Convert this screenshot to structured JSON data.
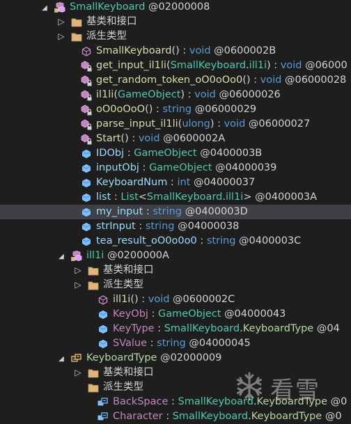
{
  "tree": {
    "rows": [
      {
        "indent": 78,
        "arrow": "open",
        "icon": "class-icon",
        "parts": [
          {
            "t": "SmallKeyboard",
            "c": "c-class"
          },
          {
            "t": " @02000008",
            "c": "c-plain"
          }
        ]
      },
      {
        "indent": 102,
        "arrow": "closed",
        "icon": "folder-icon",
        "parts": [
          {
            "t": "基类和接口",
            "c": "c-folder"
          }
        ]
      },
      {
        "indent": 102,
        "arrow": "closed",
        "icon": "folder-icon",
        "parts": [
          {
            "t": "派生类型",
            "c": "c-folder"
          }
        ]
      },
      {
        "indent": 116,
        "arrow": "none",
        "icon": "method-public-icon",
        "parts": [
          {
            "t": "SmallKeyboard",
            "c": "c-method"
          },
          {
            "t": "() : ",
            "c": "c-plain"
          },
          {
            "t": "void",
            "c": "c-kw"
          },
          {
            "t": " @0600002B",
            "c": "c-plain"
          }
        ]
      },
      {
        "indent": 116,
        "arrow": "none",
        "icon": "method-private-icon",
        "parts": [
          {
            "t": "get_input_il1li",
            "c": "c-method"
          },
          {
            "t": "(",
            "c": "c-plain"
          },
          {
            "t": "SmallKeyboard",
            "c": "c-class"
          },
          {
            "t": ".",
            "c": "c-plain"
          },
          {
            "t": "ill1i",
            "c": "c-class"
          },
          {
            "t": ") : ",
            "c": "c-plain"
          },
          {
            "t": "void",
            "c": "c-kw"
          },
          {
            "t": " @06000",
            "c": "c-plain"
          }
        ]
      },
      {
        "indent": 116,
        "arrow": "none",
        "icon": "method-private-icon",
        "parts": [
          {
            "t": "get_random_token_oO0oOo0",
            "c": "c-method"
          },
          {
            "t": "() : ",
            "c": "c-plain"
          },
          {
            "t": "void",
            "c": "c-kw"
          },
          {
            "t": " @06000028",
            "c": "c-plain"
          }
        ]
      },
      {
        "indent": 116,
        "arrow": "none",
        "icon": "method-private-icon",
        "parts": [
          {
            "t": "il1li",
            "c": "c-method"
          },
          {
            "t": "(",
            "c": "c-plain"
          },
          {
            "t": "GameObject",
            "c": "c-class"
          },
          {
            "t": ") : ",
            "c": "c-plain"
          },
          {
            "t": "void",
            "c": "c-kw"
          },
          {
            "t": " @06000026",
            "c": "c-plain"
          }
        ]
      },
      {
        "indent": 116,
        "arrow": "none",
        "icon": "method-private-icon",
        "parts": [
          {
            "t": "oO0oOoO",
            "c": "c-method"
          },
          {
            "t": "() : ",
            "c": "c-plain"
          },
          {
            "t": "string",
            "c": "c-kw"
          },
          {
            "t": " @06000029",
            "c": "c-plain"
          }
        ]
      },
      {
        "indent": 116,
        "arrow": "none",
        "icon": "method-private-icon",
        "parts": [
          {
            "t": "parse_input_il1li",
            "c": "c-method"
          },
          {
            "t": "(",
            "c": "c-plain"
          },
          {
            "t": "ulong",
            "c": "c-kw"
          },
          {
            "t": ") : ",
            "c": "c-plain"
          },
          {
            "t": "void",
            "c": "c-kw"
          },
          {
            "t": " @06000027",
            "c": "c-plain"
          }
        ]
      },
      {
        "indent": 116,
        "arrow": "none",
        "icon": "method-private-icon",
        "parts": [
          {
            "t": "Start",
            "c": "c-method"
          },
          {
            "t": "() : ",
            "c": "c-plain"
          },
          {
            "t": "void",
            "c": "c-kw"
          },
          {
            "t": " @0600002A",
            "c": "c-plain"
          }
        ]
      },
      {
        "indent": 116,
        "arrow": "none",
        "icon": "field-icon",
        "parts": [
          {
            "t": "IDObj",
            "c": "c-field"
          },
          {
            "t": " : ",
            "c": "c-plain"
          },
          {
            "t": "GameObject",
            "c": "c-class"
          },
          {
            "t": " @0400003B",
            "c": "c-plain"
          }
        ]
      },
      {
        "indent": 116,
        "arrow": "none",
        "icon": "field-icon",
        "parts": [
          {
            "t": "inputObj",
            "c": "c-field"
          },
          {
            "t": " : ",
            "c": "c-plain"
          },
          {
            "t": "GameObject",
            "c": "c-class"
          },
          {
            "t": " @04000039",
            "c": "c-plain"
          }
        ]
      },
      {
        "indent": 116,
        "arrow": "none",
        "icon": "field-icon",
        "parts": [
          {
            "t": "KeyboardNum",
            "c": "c-field"
          },
          {
            "t": " : ",
            "c": "c-plain"
          },
          {
            "t": "int",
            "c": "c-kw"
          },
          {
            "t": " @04000037",
            "c": "c-plain"
          }
        ]
      },
      {
        "indent": 116,
        "arrow": "none",
        "icon": "field-icon",
        "parts": [
          {
            "t": "list",
            "c": "c-field"
          },
          {
            "t": " : ",
            "c": "c-plain"
          },
          {
            "t": "List",
            "c": "c-class"
          },
          {
            "t": "<",
            "c": "c-plain"
          },
          {
            "t": "SmallKeyboard",
            "c": "c-class"
          },
          {
            "t": ".",
            "c": "c-plain"
          },
          {
            "t": "ill1i",
            "c": "c-class"
          },
          {
            "t": "> @0400003A",
            "c": "c-plain"
          }
        ]
      },
      {
        "indent": 116,
        "arrow": "none",
        "icon": "field-icon",
        "selected": true,
        "parts": [
          {
            "t": "my_input",
            "c": "c-field"
          },
          {
            "t": " : ",
            "c": "c-plain"
          },
          {
            "t": "string",
            "c": "c-kw"
          },
          {
            "t": " @0400003D",
            "c": "c-plain"
          }
        ]
      },
      {
        "indent": 116,
        "arrow": "none",
        "icon": "field-icon",
        "parts": [
          {
            "t": "strInput",
            "c": "c-field"
          },
          {
            "t": " : ",
            "c": "c-plain"
          },
          {
            "t": "string",
            "c": "c-kw"
          },
          {
            "t": " @04000038",
            "c": "c-plain"
          }
        ]
      },
      {
        "indent": 116,
        "arrow": "none",
        "icon": "field-icon",
        "parts": [
          {
            "t": "tea_result_oO0o0o0",
            "c": "c-field"
          },
          {
            "t": " : ",
            "c": "c-plain"
          },
          {
            "t": "string",
            "c": "c-kw"
          },
          {
            "t": " @0400003C",
            "c": "c-plain"
          }
        ]
      },
      {
        "indent": 102,
        "arrow": "open",
        "icon": "class-icon",
        "parts": [
          {
            "t": "ill1i",
            "c": "c-class"
          },
          {
            "t": " @0200000A",
            "c": "c-plain"
          }
        ]
      },
      {
        "indent": 126,
        "arrow": "closed",
        "icon": "folder-icon",
        "parts": [
          {
            "t": "基类和接口",
            "c": "c-folder"
          }
        ]
      },
      {
        "indent": 126,
        "arrow": "closed",
        "icon": "folder-icon",
        "parts": [
          {
            "t": "派生类型",
            "c": "c-folder"
          }
        ]
      },
      {
        "indent": 140,
        "arrow": "none",
        "icon": "method-public-icon",
        "parts": [
          {
            "t": "ill1i",
            "c": "c-method"
          },
          {
            "t": "() : ",
            "c": "c-plain"
          },
          {
            "t": "void",
            "c": "c-kw"
          },
          {
            "t": " @0600002C",
            "c": "c-plain"
          }
        ]
      },
      {
        "indent": 140,
        "arrow": "none",
        "icon": "field-icon",
        "parts": [
          {
            "t": "KeyObj",
            "c": "c-member"
          },
          {
            "t": " : ",
            "c": "c-plain"
          },
          {
            "t": "GameObject",
            "c": "c-class"
          },
          {
            "t": " @04000043",
            "c": "c-plain"
          }
        ]
      },
      {
        "indent": 140,
        "arrow": "none",
        "icon": "field-icon",
        "parts": [
          {
            "t": "KeyType",
            "c": "c-member"
          },
          {
            "t": " : ",
            "c": "c-plain"
          },
          {
            "t": "SmallKeyboard",
            "c": "c-class"
          },
          {
            "t": ".",
            "c": "c-plain"
          },
          {
            "t": "KeyboardType",
            "c": "c-enum"
          },
          {
            "t": " @04",
            "c": "c-plain"
          }
        ]
      },
      {
        "indent": 140,
        "arrow": "none",
        "icon": "field-icon",
        "parts": [
          {
            "t": "SValue",
            "c": "c-member"
          },
          {
            "t": " : ",
            "c": "c-plain"
          },
          {
            "t": "string",
            "c": "c-kw"
          },
          {
            "t": " @04000045",
            "c": "c-plain"
          }
        ]
      },
      {
        "indent": 102,
        "arrow": "open",
        "icon": "enum-icon",
        "parts": [
          {
            "t": "KeyboardType",
            "c": "c-enum"
          },
          {
            "t": " @02000009",
            "c": "c-plain"
          }
        ]
      },
      {
        "indent": 126,
        "arrow": "closed",
        "icon": "folder-icon",
        "parts": [
          {
            "t": "基类和接口",
            "c": "c-folder"
          }
        ]
      },
      {
        "indent": 126,
        "arrow": "none",
        "icon": "folder-icon",
        "parts": [
          {
            "t": "派生类型",
            "c": "c-folder"
          }
        ]
      },
      {
        "indent": 140,
        "arrow": "none",
        "icon": "enum-member-icon",
        "parts": [
          {
            "t": "BackSpace",
            "c": "c-member"
          },
          {
            "t": " : ",
            "c": "c-plain"
          },
          {
            "t": "SmallKeyboard",
            "c": "c-class"
          },
          {
            "t": ".",
            "c": "c-plain"
          },
          {
            "t": "KeyboardType",
            "c": "c-enum"
          },
          {
            "t": " @0",
            "c": "c-plain"
          }
        ]
      },
      {
        "indent": 140,
        "arrow": "none",
        "icon": "enum-member-icon",
        "parts": [
          {
            "t": "Character",
            "c": "c-member"
          },
          {
            "t": " : ",
            "c": "c-plain"
          },
          {
            "t": "SmallKeyboard",
            "c": "c-class"
          },
          {
            "t": ".",
            "c": "c-plain"
          },
          {
            "t": "KeyboardType",
            "c": "c-enum"
          },
          {
            "t": " @0",
            "c": "c-plain"
          }
        ]
      }
    ]
  },
  "watermark": {
    "text": "看雪",
    "icon": "snowflake-icon"
  }
}
